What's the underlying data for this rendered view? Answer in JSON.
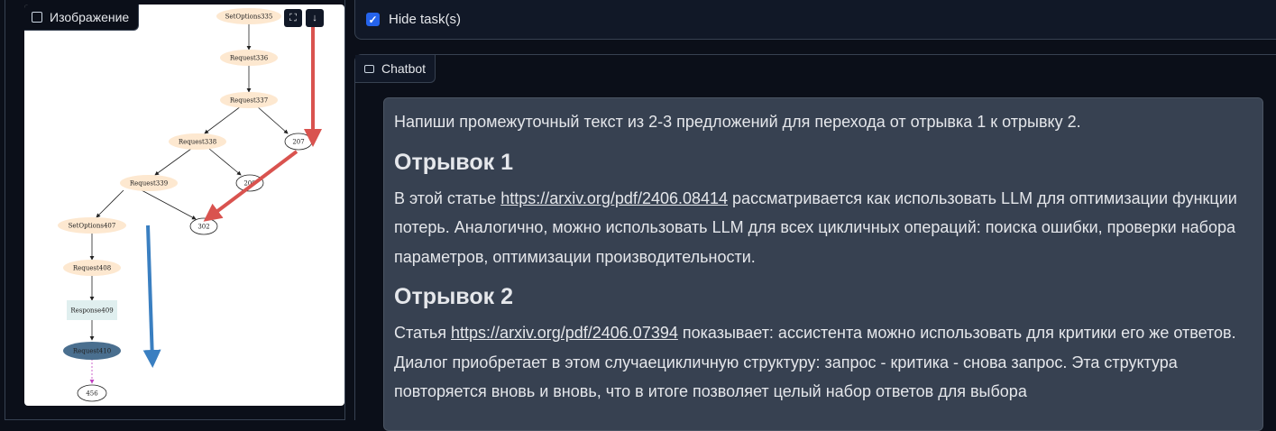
{
  "image_panel": {
    "label": "Изображение",
    "graph_nodes": {
      "setoptions335": "SetOptions335",
      "request336": "Request336",
      "request337": "Request337",
      "request338": "Request338",
      "n207": "207",
      "request339": "Request339",
      "n209": "209",
      "setoptions407": "SetOptions407",
      "n302": "302",
      "request408": "Request408",
      "response409": "Response409",
      "request410": "Request410",
      "n456": "456"
    }
  },
  "task_toggle": {
    "label": "Hide task(s)",
    "checked": true
  },
  "chatbot": {
    "label": "Chatbot",
    "message": {
      "intro": "Напиши промежуточный текст из 2-3 предложений для перехода от отрывка 1 к отрывку 2.",
      "heading1": "Отрывок 1",
      "p1_before": "В этой статье ",
      "p1_link": "https://arxiv.org/pdf/2406.08414",
      "p1_after": " рассматривается как использовать LLM для оптимизации функции потерь. Аналогично, можно использовать LLM для всех цикличных операций: поиска ошибки, проверки набора параметров, оптимизации производительности.",
      "heading2": "Отрывок 2",
      "p2_before": "Статья ",
      "p2_link": "https://arxiv.org/pdf/2406.07394",
      "p2_after": " показывает: ассистента можно использовать для критики его же ответов. Диалог приобретает в этом случаецикличную структуру: запрос - критика - снова запрос. Эта структура повторяется вновь и вновь, что в итоге позволяет целый набор ответов для выбора"
    }
  },
  "colors": {
    "accent": "#2563eb",
    "arrow_red": "#d9534f",
    "arrow_blue": "#3a7fc1",
    "node_fill": "#fde8d0"
  }
}
